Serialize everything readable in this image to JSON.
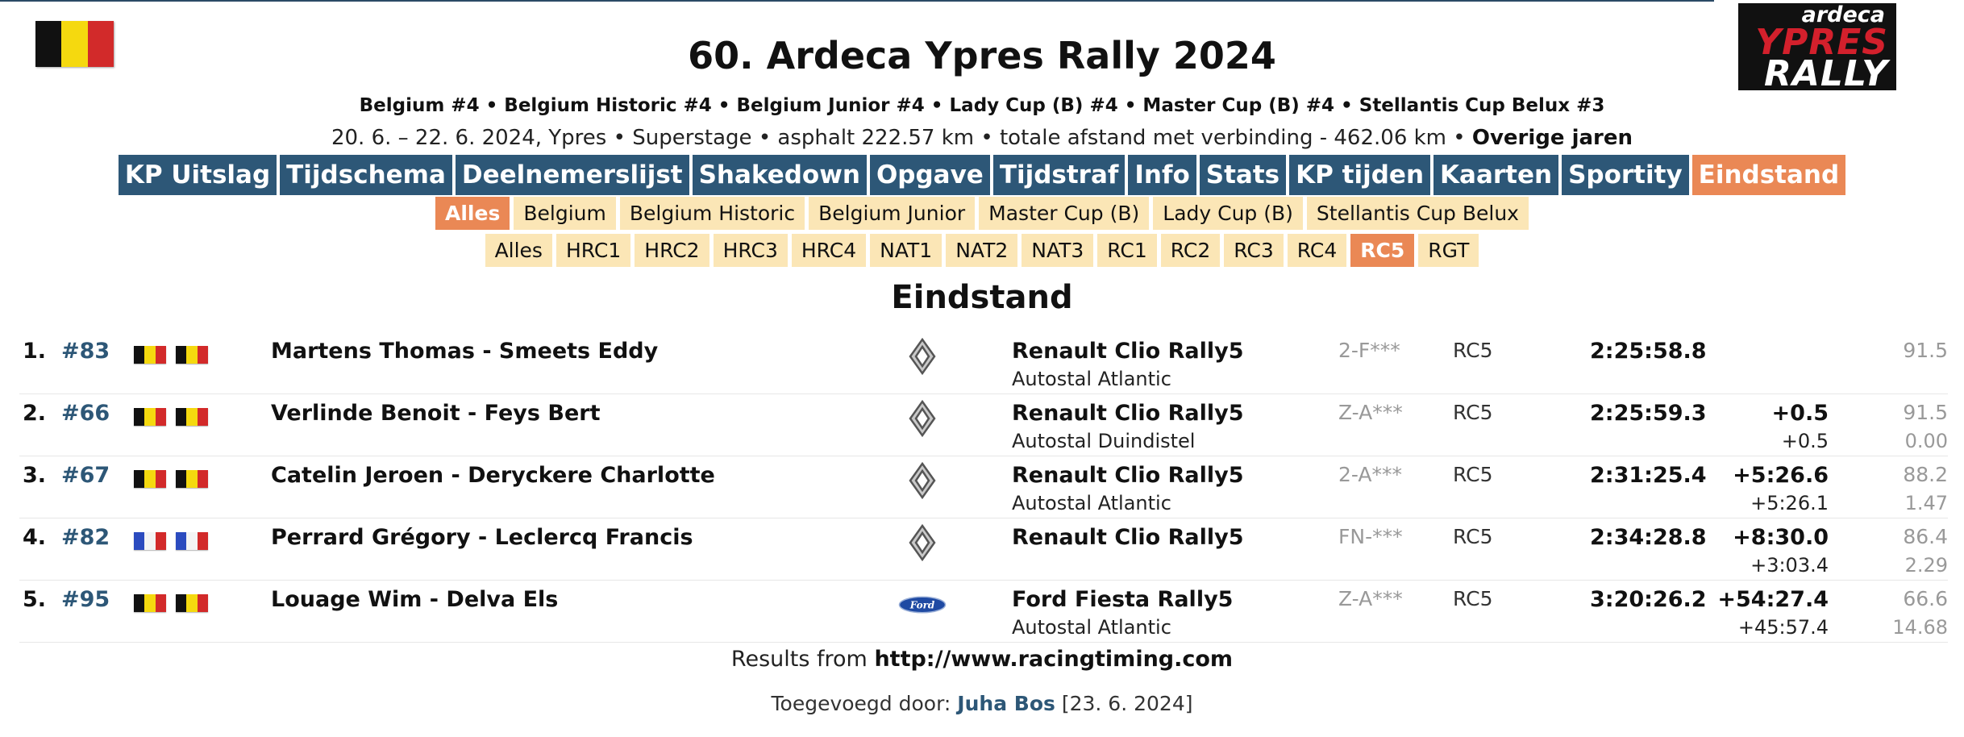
{
  "colors": {
    "nav_primary": "#2d5777",
    "nav_active": "#ea8855",
    "chip_bg": "#fbe6b6",
    "link": "#2d5777",
    "muted": "#999999"
  },
  "header": {
    "flag": "belgium-flag-icon",
    "title": "60. Ardeca Ypres Rally 2024",
    "series": "Belgium #4 • Belgium Historic #4 • Belgium Junior #4 • Lady Cup (B) #4 • Master Cup (B) #4 • Stellantis Cup Belux #3",
    "info_text": "20. 6. – 22. 6. 2024, Ypres • Superstage • asphalt 222.57 km • totale afstand met verbinding - 462.06 km •",
    "info_link": "Overige jaren",
    "logo": {
      "line1": "ardeca",
      "line2": "YPRES",
      "line3": "RALLY"
    }
  },
  "nav_main": [
    {
      "label": "KP Uitslag",
      "active": false
    },
    {
      "label": "Tijdschema",
      "active": false
    },
    {
      "label": "Deelnemerslijst",
      "active": false
    },
    {
      "label": "Shakedown",
      "active": false
    },
    {
      "label": "Opgave",
      "active": false
    },
    {
      "label": "Tijdstraf",
      "active": false
    },
    {
      "label": "Info",
      "active": false
    },
    {
      "label": "Stats",
      "active": false
    },
    {
      "label": "KP tijden",
      "active": false
    },
    {
      "label": "Kaarten",
      "active": false
    },
    {
      "label": "Sportity",
      "active": false
    },
    {
      "label": "Eindstand",
      "active": true
    }
  ],
  "nav_cups": [
    {
      "label": "Alles",
      "active": true
    },
    {
      "label": "Belgium",
      "active": false
    },
    {
      "label": "Belgium Historic",
      "active": false
    },
    {
      "label": "Belgium Junior",
      "active": false
    },
    {
      "label": "Master Cup (B)",
      "active": false
    },
    {
      "label": "Lady Cup (B)",
      "active": false
    },
    {
      "label": "Stellantis Cup Belux",
      "active": false
    }
  ],
  "nav_classes": [
    {
      "label": "Alles",
      "active": false
    },
    {
      "label": "HRC1",
      "active": false
    },
    {
      "label": "HRC2",
      "active": false
    },
    {
      "label": "HRC3",
      "active": false
    },
    {
      "label": "HRC4",
      "active": false
    },
    {
      "label": "NAT1",
      "active": false
    },
    {
      "label": "NAT2",
      "active": false
    },
    {
      "label": "NAT3",
      "active": false
    },
    {
      "label": "RC1",
      "active": false
    },
    {
      "label": "RC2",
      "active": false
    },
    {
      "label": "RC3",
      "active": false
    },
    {
      "label": "RC4",
      "active": false
    },
    {
      "label": "RC5",
      "active": true
    },
    {
      "label": "RGT",
      "active": false
    }
  ],
  "section_title": "Eindstand",
  "results": [
    {
      "pos": "1.",
      "num": "#83",
      "flags": [
        "be",
        "be"
      ],
      "crew": "Martens Thomas - Smeets Eddy",
      "brand": "renault",
      "car": "Renault Clio Rally5",
      "team": "Autostal Atlantic",
      "plate": "2-F***",
      "cls": "RC5",
      "time": "2:25:58.8",
      "gap": "",
      "gap_prev": "",
      "speed": "91.5",
      "speed_diff": ""
    },
    {
      "pos": "2.",
      "num": "#66",
      "flags": [
        "be",
        "be"
      ],
      "crew": "Verlinde Benoit - Feys Bert",
      "brand": "renault",
      "car": "Renault Clio Rally5",
      "team": "Autostal Duindistel",
      "plate": "Z-A***",
      "cls": "RC5",
      "time": "2:25:59.3",
      "gap": "+0.5",
      "gap_prev": "+0.5",
      "speed": "91.5",
      "speed_diff": "0.00"
    },
    {
      "pos": "3.",
      "num": "#67",
      "flags": [
        "be",
        "be"
      ],
      "crew": "Catelin Jeroen - Deryckere Charlotte",
      "brand": "renault",
      "car": "Renault Clio Rally5",
      "team": "Autostal Atlantic",
      "plate": "2-A***",
      "cls": "RC5",
      "time": "2:31:25.4",
      "gap": "+5:26.6",
      "gap_prev": "+5:26.1",
      "speed": "88.2",
      "speed_diff": "1.47"
    },
    {
      "pos": "4.",
      "num": "#82",
      "flags": [
        "fr",
        "fr"
      ],
      "crew": "Perrard Grégory - Leclercq Francis",
      "brand": "renault",
      "car": "Renault Clio Rally5",
      "team": "",
      "plate": "FN-***",
      "cls": "RC5",
      "time": "2:34:28.8",
      "gap": "+8:30.0",
      "gap_prev": "+3:03.4",
      "speed": "86.4",
      "speed_diff": "2.29"
    },
    {
      "pos": "5.",
      "num": "#95",
      "flags": [
        "be",
        "be"
      ],
      "crew": "Louage Wim - Delva Els",
      "brand": "ford",
      "car": "Ford Fiesta Rally5",
      "team": "Autostal Atlantic",
      "plate": "Z-A***",
      "cls": "RC5",
      "time": "3:20:26.2",
      "gap": "+54:27.4",
      "gap_prev": "+45:57.4",
      "speed": "66.6",
      "speed_diff": "14.68"
    }
  ],
  "footer": {
    "source_prefix": "Results from",
    "source_url": "http://www.racingtiming.com",
    "added_prefix": "Toegevoegd door:",
    "added_by": "Juha Bos",
    "added_date": "[23. 6. 2024]"
  }
}
